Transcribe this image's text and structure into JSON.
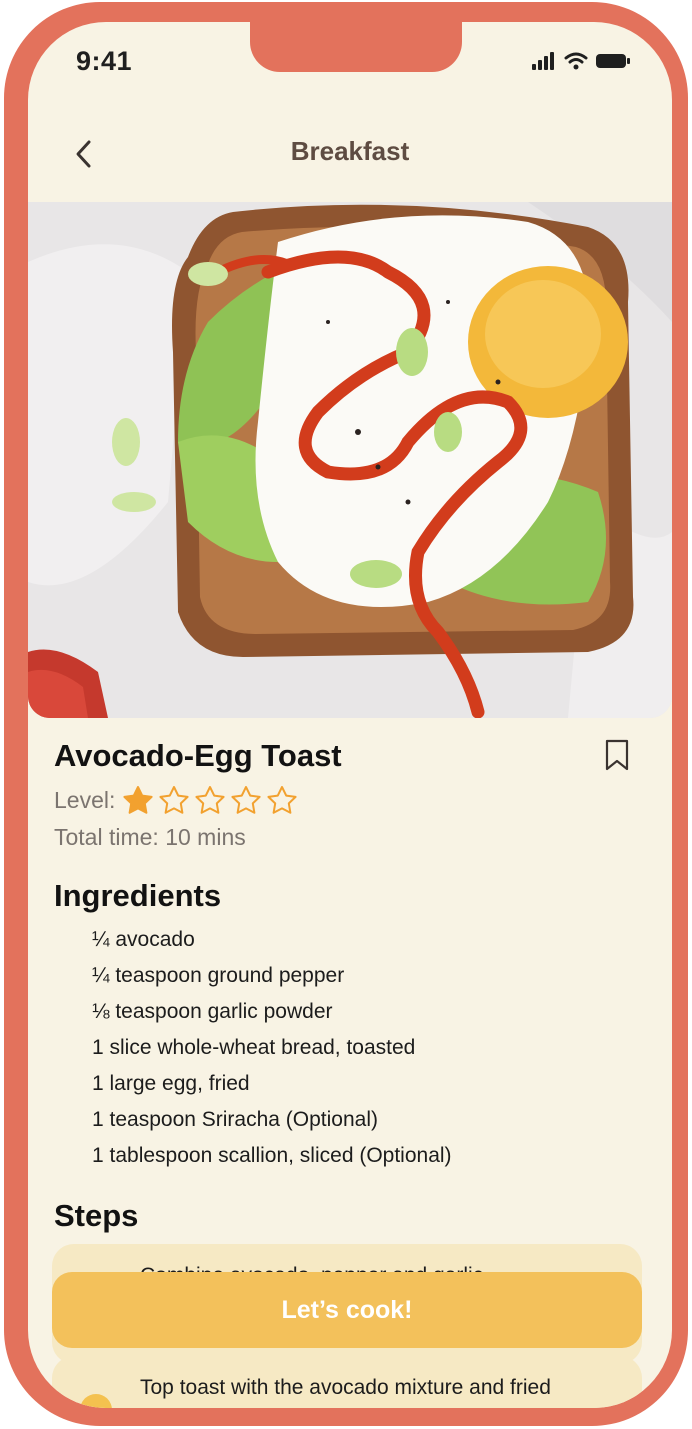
{
  "status_bar": {
    "time": "9:41"
  },
  "header": {
    "title": "Breakfast"
  },
  "recipe": {
    "title": "Avocado-Egg Toast",
    "level_label": "Level:",
    "level_rating": 1,
    "level_max": 5,
    "total_time": "Total time: 10 mins"
  },
  "ingredients": {
    "heading": "Ingredients",
    "items": [
      "¼ avocado",
      "¼ teaspoon ground pepper",
      "⅛ teaspoon garlic powder",
      "1 slice whole-wheat bread, toasted",
      "1 large egg, fried",
      "1 teaspoon Sriracha (Optional)",
      "1 tablespoon scallion, sliced (Optional)"
    ]
  },
  "steps": {
    "heading": "Steps",
    "items": [
      "Combine avocado, pepper and garlic",
      "Top toast with the avocado mixture and fried"
    ]
  },
  "cta": {
    "label": "Let’s cook!"
  },
  "colors": {
    "frame": "#E3725C",
    "background": "#F8F3E4",
    "accent": "#F3C15B",
    "star": "#F2A12F"
  }
}
